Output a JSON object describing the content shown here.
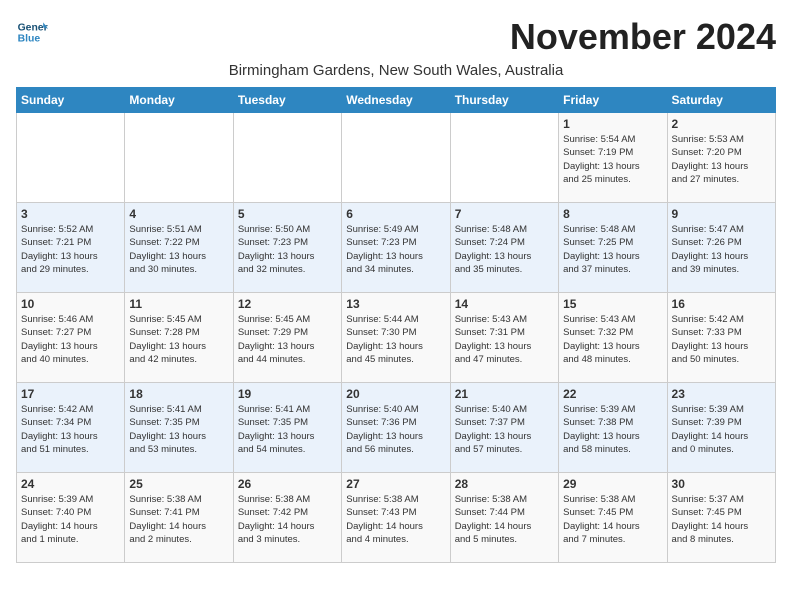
{
  "header": {
    "logo_line1": "General",
    "logo_line2": "Blue",
    "month": "November 2024",
    "location": "Birmingham Gardens, New South Wales, Australia"
  },
  "weekdays": [
    "Sunday",
    "Monday",
    "Tuesday",
    "Wednesday",
    "Thursday",
    "Friday",
    "Saturday"
  ],
  "weeks": [
    [
      {
        "day": "",
        "info": ""
      },
      {
        "day": "",
        "info": ""
      },
      {
        "day": "",
        "info": ""
      },
      {
        "day": "",
        "info": ""
      },
      {
        "day": "",
        "info": ""
      },
      {
        "day": "1",
        "info": "Sunrise: 5:54 AM\nSunset: 7:19 PM\nDaylight: 13 hours\nand 25 minutes."
      },
      {
        "day": "2",
        "info": "Sunrise: 5:53 AM\nSunset: 7:20 PM\nDaylight: 13 hours\nand 27 minutes."
      }
    ],
    [
      {
        "day": "3",
        "info": "Sunrise: 5:52 AM\nSunset: 7:21 PM\nDaylight: 13 hours\nand 29 minutes."
      },
      {
        "day": "4",
        "info": "Sunrise: 5:51 AM\nSunset: 7:22 PM\nDaylight: 13 hours\nand 30 minutes."
      },
      {
        "day": "5",
        "info": "Sunrise: 5:50 AM\nSunset: 7:23 PM\nDaylight: 13 hours\nand 32 minutes."
      },
      {
        "day": "6",
        "info": "Sunrise: 5:49 AM\nSunset: 7:23 PM\nDaylight: 13 hours\nand 34 minutes."
      },
      {
        "day": "7",
        "info": "Sunrise: 5:48 AM\nSunset: 7:24 PM\nDaylight: 13 hours\nand 35 minutes."
      },
      {
        "day": "8",
        "info": "Sunrise: 5:48 AM\nSunset: 7:25 PM\nDaylight: 13 hours\nand 37 minutes."
      },
      {
        "day": "9",
        "info": "Sunrise: 5:47 AM\nSunset: 7:26 PM\nDaylight: 13 hours\nand 39 minutes."
      }
    ],
    [
      {
        "day": "10",
        "info": "Sunrise: 5:46 AM\nSunset: 7:27 PM\nDaylight: 13 hours\nand 40 minutes."
      },
      {
        "day": "11",
        "info": "Sunrise: 5:45 AM\nSunset: 7:28 PM\nDaylight: 13 hours\nand 42 minutes."
      },
      {
        "day": "12",
        "info": "Sunrise: 5:45 AM\nSunset: 7:29 PM\nDaylight: 13 hours\nand 44 minutes."
      },
      {
        "day": "13",
        "info": "Sunrise: 5:44 AM\nSunset: 7:30 PM\nDaylight: 13 hours\nand 45 minutes."
      },
      {
        "day": "14",
        "info": "Sunrise: 5:43 AM\nSunset: 7:31 PM\nDaylight: 13 hours\nand 47 minutes."
      },
      {
        "day": "15",
        "info": "Sunrise: 5:43 AM\nSunset: 7:32 PM\nDaylight: 13 hours\nand 48 minutes."
      },
      {
        "day": "16",
        "info": "Sunrise: 5:42 AM\nSunset: 7:33 PM\nDaylight: 13 hours\nand 50 minutes."
      }
    ],
    [
      {
        "day": "17",
        "info": "Sunrise: 5:42 AM\nSunset: 7:34 PM\nDaylight: 13 hours\nand 51 minutes."
      },
      {
        "day": "18",
        "info": "Sunrise: 5:41 AM\nSunset: 7:35 PM\nDaylight: 13 hours\nand 53 minutes."
      },
      {
        "day": "19",
        "info": "Sunrise: 5:41 AM\nSunset: 7:35 PM\nDaylight: 13 hours\nand 54 minutes."
      },
      {
        "day": "20",
        "info": "Sunrise: 5:40 AM\nSunset: 7:36 PM\nDaylight: 13 hours\nand 56 minutes."
      },
      {
        "day": "21",
        "info": "Sunrise: 5:40 AM\nSunset: 7:37 PM\nDaylight: 13 hours\nand 57 minutes."
      },
      {
        "day": "22",
        "info": "Sunrise: 5:39 AM\nSunset: 7:38 PM\nDaylight: 13 hours\nand 58 minutes."
      },
      {
        "day": "23",
        "info": "Sunrise: 5:39 AM\nSunset: 7:39 PM\nDaylight: 14 hours\nand 0 minutes."
      }
    ],
    [
      {
        "day": "24",
        "info": "Sunrise: 5:39 AM\nSunset: 7:40 PM\nDaylight: 14 hours\nand 1 minute."
      },
      {
        "day": "25",
        "info": "Sunrise: 5:38 AM\nSunset: 7:41 PM\nDaylight: 14 hours\nand 2 minutes."
      },
      {
        "day": "26",
        "info": "Sunrise: 5:38 AM\nSunset: 7:42 PM\nDaylight: 14 hours\nand 3 minutes."
      },
      {
        "day": "27",
        "info": "Sunrise: 5:38 AM\nSunset: 7:43 PM\nDaylight: 14 hours\nand 4 minutes."
      },
      {
        "day": "28",
        "info": "Sunrise: 5:38 AM\nSunset: 7:44 PM\nDaylight: 14 hours\nand 5 minutes."
      },
      {
        "day": "29",
        "info": "Sunrise: 5:38 AM\nSunset: 7:45 PM\nDaylight: 14 hours\nand 7 minutes."
      },
      {
        "day": "30",
        "info": "Sunrise: 5:37 AM\nSunset: 7:45 PM\nDaylight: 14 hours\nand 8 minutes."
      }
    ]
  ]
}
